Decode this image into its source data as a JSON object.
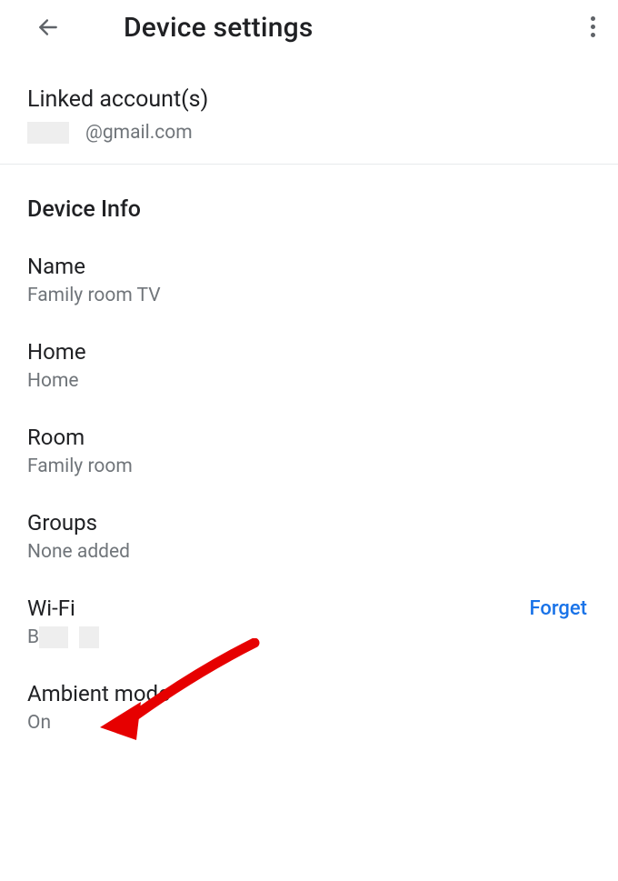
{
  "header": {
    "title": "Device settings"
  },
  "linked": {
    "title": "Linked account(s)",
    "email_suffix": "@gmail.com"
  },
  "sections": {
    "device_info_header": "Device Info"
  },
  "items": {
    "name": {
      "label": "Name",
      "value": "Family room TV"
    },
    "home": {
      "label": "Home",
      "value": "Home"
    },
    "room": {
      "label": "Room",
      "value": "Family room"
    },
    "groups": {
      "label": "Groups",
      "value": "None added"
    },
    "wifi": {
      "label": "Wi-Fi",
      "value_prefix": "B",
      "forget": "Forget"
    },
    "ambient": {
      "label": "Ambient mode",
      "value": "On"
    }
  },
  "annotation": {
    "type": "arrow",
    "target": "wifi",
    "color": "#e60000"
  }
}
